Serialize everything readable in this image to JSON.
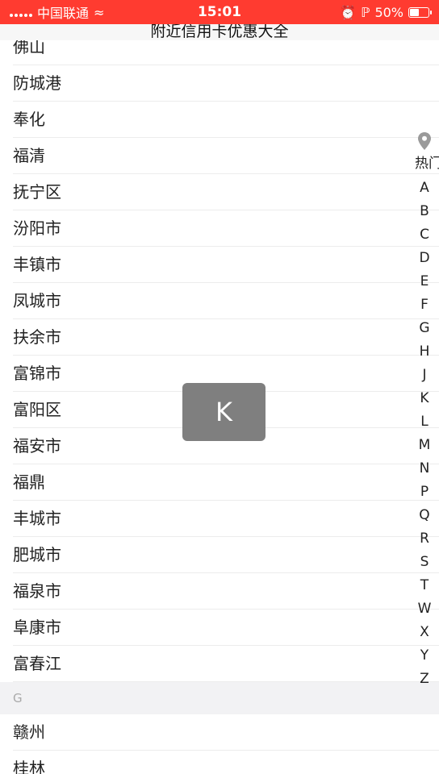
{
  "status_bar": {
    "carrier": "中国联通",
    "time": "15:01",
    "battery_text": "50%",
    "battery_level": 0.5
  },
  "nav": {
    "title": "附近信用卡优惠大全"
  },
  "partial_top": "佛山",
  "cities_f": [
    "防城港",
    "奉化",
    "福清",
    "抚宁区",
    "汾阳市",
    "丰镇市",
    "凤城市",
    "扶余市",
    "富锦市",
    "富阳区",
    "福安市",
    "福鼎",
    "丰城市",
    "肥城市",
    "福泉市",
    "阜康市",
    "富春江"
  ],
  "section_g": {
    "header": "G",
    "cities": [
      "赣州",
      "桂林"
    ]
  },
  "index": {
    "hot_label": "热门",
    "letters": [
      "A",
      "B",
      "C",
      "D",
      "E",
      "F",
      "G",
      "H",
      "J",
      "K",
      "L",
      "M",
      "N",
      "P",
      "Q",
      "R",
      "S",
      "T",
      "W",
      "X",
      "Y",
      "Z"
    ]
  },
  "toast": {
    "letter": "K"
  },
  "colors": {
    "status_bar": "#ff3b30",
    "toast": "#7f7f7f"
  }
}
